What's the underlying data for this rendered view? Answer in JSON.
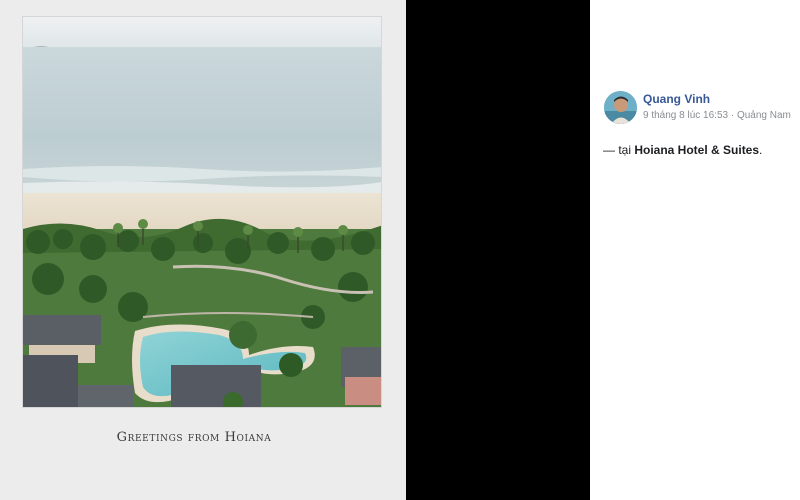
{
  "photo": {
    "caption": "Greetings from Hoiana",
    "alt": "Aerial view of beach, palm trees and hotel pool"
  },
  "post": {
    "author": "Quang Vinh",
    "date": "9 tháng 8 lúc 16:53",
    "separator": " · ",
    "location": "Quảng Nam",
    "text_prefix": "— tại ",
    "place": "Hoiana Hotel & Suites",
    "text_suffix": "."
  },
  "icons": {
    "avatar": "avatar-photo"
  },
  "colors": {
    "author_link": "#385898",
    "meta_gray": "#8a8d91",
    "viewer_bg": "#000000",
    "postcard_bg": "#ececec"
  }
}
